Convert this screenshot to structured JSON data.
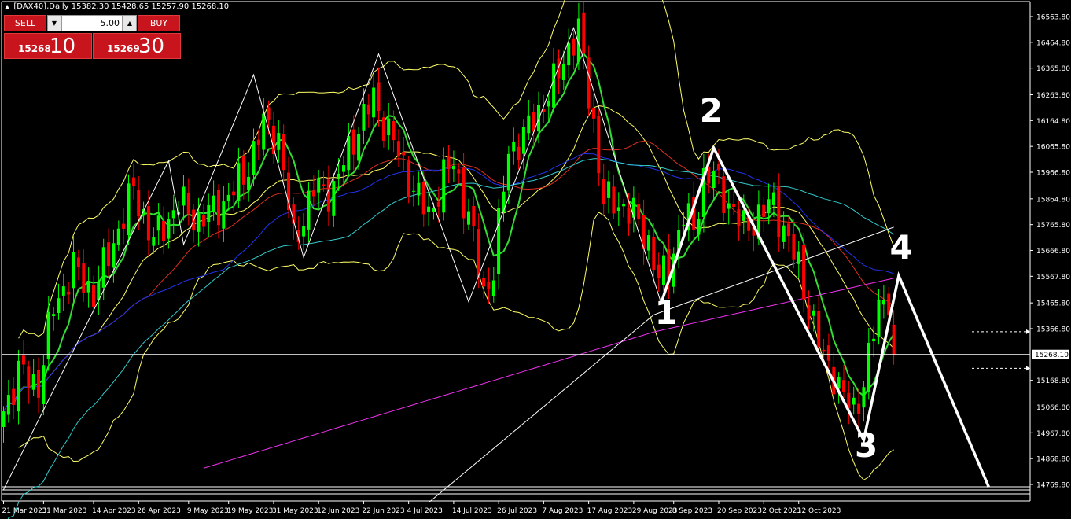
{
  "header": {
    "arrow": "▲",
    "symbol": "[DAX40],Daily",
    "ohlc": "15382.30 15428.65 15257.90 15268.10"
  },
  "trade_panel": {
    "sell_label": "SELL",
    "buy_label": "BUY",
    "lot_value": "5.00",
    "down_arrow": "▼",
    "up_arrow": "▲",
    "sell_small": "15268",
    "sell_big": "10",
    "buy_small": "15269",
    "buy_big": "30"
  },
  "colors": {
    "background": "#000000",
    "bull": "#00ff00",
    "bear": "#ff0000",
    "wave": "#ffffff",
    "bollinger": "#ffff66",
    "fast_ma": "#33dd33",
    "red_ma": "#e03020",
    "blue_ma": "#2233ee",
    "cyan_ma": "#33cccc",
    "magenta_ma": "#ee33ee",
    "white_ma": "#ffffff"
  },
  "chart_data": {
    "type": "candlestick",
    "y_ticks": [
      "16563.80",
      "16464.80",
      "16365.80",
      "16263.80",
      "16164.80",
      "16065.80",
      "15966.80",
      "15864.80",
      "15765.80",
      "15666.80",
      "15567.80",
      "15465.80",
      "15366.80",
      "15268.10",
      "15168.80",
      "15066.80",
      "14967.80",
      "14868.80",
      "14769.80"
    ],
    "current_price": "15268.10",
    "x_ticks": [
      "21 Mar 2023",
      "31 Mar 2023",
      "14 Apr 2023",
      "26 Apr 2023",
      "9 May 2023",
      "19 May 2023",
      "31 May 2023",
      "12 Jun 2023",
      "22 Jun 2023",
      "4 Jul 2023",
      "14 Jul 2023",
      "26 Jul 2023",
      "7 Aug 2023",
      "17 Aug 2023",
      "29 Aug 2023",
      "8 Sep 2023",
      "20 Sep 2023",
      "2 Oct 2023",
      "12 Oct 2023"
    ],
    "close_anchors": [
      [
        0,
        15050
      ],
      [
        3,
        15200
      ],
      [
        7,
        15150
      ],
      [
        10,
        15450
      ],
      [
        14,
        15600
      ],
      [
        18,
        15500
      ],
      [
        22,
        15700
      ],
      [
        26,
        15900
      ],
      [
        30,
        15700
      ],
      [
        35,
        15850
      ],
      [
        39,
        15780
      ],
      [
        44,
        15850
      ],
      [
        48,
        15950
      ],
      [
        52,
        16150
      ],
      [
        55,
        16100
      ],
      [
        58,
        15700
      ],
      [
        62,
        15900
      ],
      [
        66,
        15900
      ],
      [
        70,
        16100
      ],
      [
        74,
        16250
      ],
      [
        78,
        16080
      ],
      [
        82,
        15900
      ],
      [
        85,
        15800
      ],
      [
        88,
        15950
      ],
      [
        90,
        16000
      ],
      [
        93,
        15800
      ],
      [
        96,
        15500
      ],
      [
        98,
        15600
      ],
      [
        101,
        16050
      ],
      [
        104,
        16100
      ],
      [
        107,
        16200
      ],
      [
        110,
        16300
      ],
      [
        113,
        16450
      ],
      [
        115,
        16500
      ],
      [
        118,
        16150
      ],
      [
        120,
        15850
      ],
      [
        123,
        15850
      ],
      [
        126,
        15800
      ],
      [
        129,
        15700
      ],
      [
        131,
        15550
      ],
      [
        133,
        15600
      ],
      [
        136,
        15800
      ],
      [
        138,
        15750
      ],
      [
        140,
        15950
      ],
      [
        142,
        15950
      ],
      [
        145,
        15850
      ],
      [
        148,
        15750
      ],
      [
        151,
        15800
      ],
      [
        154,
        15850
      ],
      [
        157,
        15700
      ],
      [
        159,
        15600
      ],
      [
        161,
        15450
      ],
      [
        164,
        15250
      ],
      [
        166,
        15200
      ],
      [
        168,
        15100
      ],
      [
        170,
        15050
      ],
      [
        171,
        15100
      ],
      [
        173,
        15250
      ],
      [
        175,
        15450
      ],
      [
        177,
        15500
      ],
      [
        178,
        15268
      ]
    ],
    "wave_labels": [
      {
        "label": "1",
        "bar": 132.5,
        "price": 15385
      },
      {
        "label": "2",
        "bar": 141.5,
        "price": 16160
      },
      {
        "label": "3",
        "bar": 172.5,
        "price": 14875
      },
      {
        "label": "4",
        "bar": 179.5,
        "price": 15635
      }
    ],
    "elliott_wave": [
      [
        131.5,
        15465
      ],
      [
        142,
        16060
      ],
      [
        172,
        14940
      ],
      [
        179,
        15570
      ],
      [
        197,
        14760
      ]
    ],
    "zigzag": [
      [
        0,
        14750
      ],
      [
        33,
        16010
      ],
      [
        36,
        15690
      ],
      [
        50,
        16340
      ],
      [
        60,
        15640
      ],
      [
        75,
        16420
      ],
      [
        93,
        15470
      ],
      [
        114,
        16520
      ],
      [
        131.5,
        15465
      ]
    ],
    "grid": false
  }
}
